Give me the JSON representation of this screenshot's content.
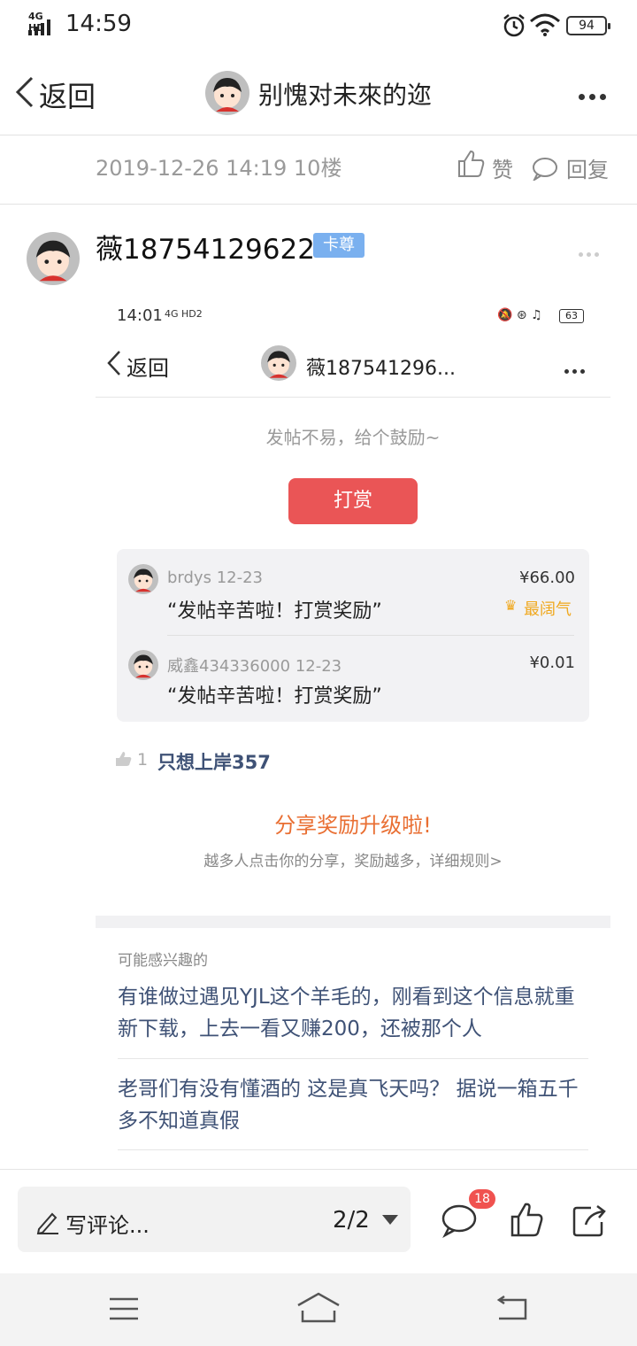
{
  "status_bar": {
    "network": "4G HD",
    "time": "14:59",
    "battery": "94"
  },
  "header": {
    "back_label": "返回",
    "title": "别愧对未來的迩"
  },
  "meta": {
    "datetime_floor": "2019-12-26 14:19  10楼",
    "like_label": "赞",
    "reply_label": "回复"
  },
  "post": {
    "username": "薇18754129622",
    "badge": "卡尊"
  },
  "embedded": {
    "status_time": "14:01",
    "status_icons": "4G HD2",
    "battery": "63",
    "back_label": "返回",
    "title": "薇187541296...",
    "encourage_text": "发帖不易，给个鼓励~",
    "tip_button": "打赏",
    "tips": [
      {
        "name": "brdys",
        "date": "12-23",
        "amount": "¥66.00",
        "message": "“发帖辛苦啦！打赏奖励”",
        "tag": "最阔气"
      },
      {
        "name": "威鑫434336000",
        "date": "12-23",
        "amount": "¥0.01",
        "message": "“发帖辛苦啦！打赏奖励”"
      }
    ],
    "like_count": "1",
    "liker": "只想上岸357",
    "share_title": "分享奖励升级啦!",
    "share_sub": "越多人点击你的分享，奖励越多，详细规则>",
    "recommend_heading": "可能感兴趣的",
    "recommendations": [
      "有谁做过遇见YJL这个羊毛的，刚看到这个信息就重新下载，上去一看又赚200，还被那个人",
      "老哥们有没有懂酒的 这是真飞天吗？ 据说一箱五千多不知道真假"
    ]
  },
  "bottom": {
    "comment_placeholder": "写评论...",
    "page": "2/2",
    "comment_count": "18"
  },
  "colors": {
    "tip_button": "#ea5556",
    "share_title": "#e96f33",
    "link_blue": "#3f5276",
    "badge": "#7ab0ef",
    "crown": "#f0a81d"
  }
}
